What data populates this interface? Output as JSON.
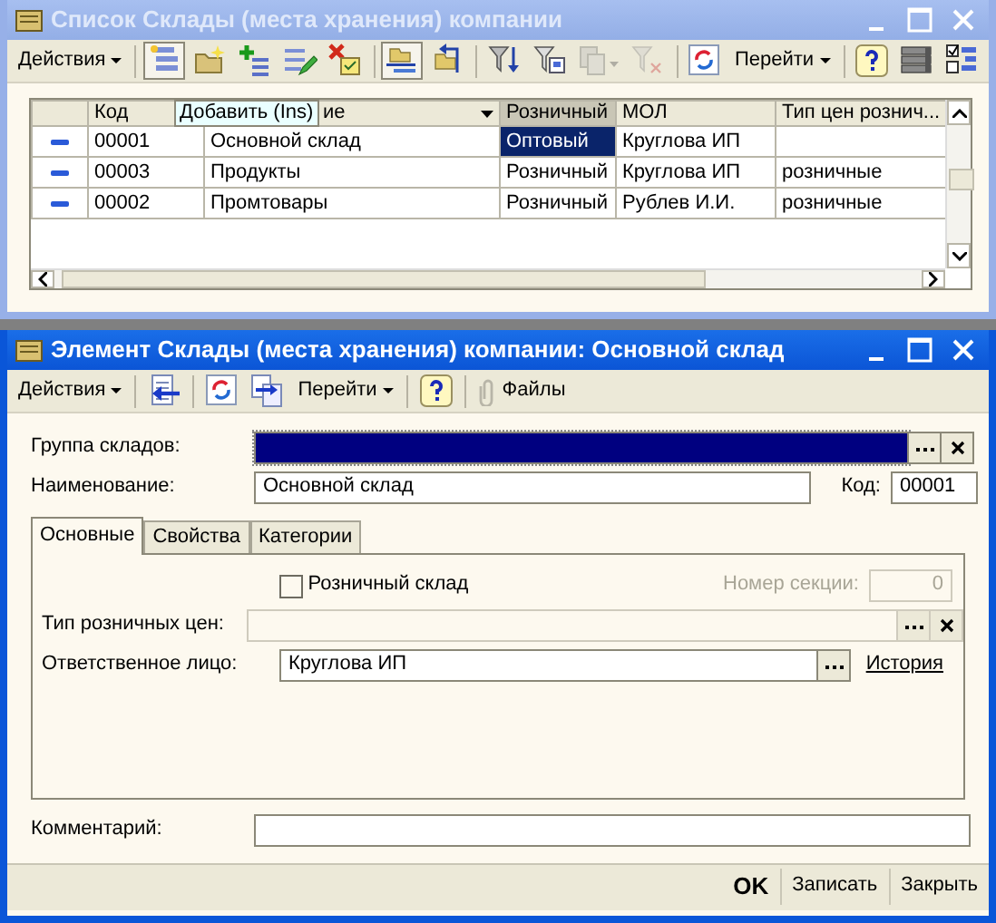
{
  "list_window": {
    "title": "Список Склады (места хранения) компании",
    "toolbar": [
      {
        "kind": "menu",
        "label": "Действия"
      },
      {
        "kind": "separator"
      },
      {
        "kind": "icon",
        "pressed": true,
        "disabled": false
      },
      {
        "kind": "icon",
        "pressed": false,
        "disabled": false
      },
      {
        "kind": "icon",
        "pressed": false,
        "disabled": false
      },
      {
        "kind": "icon",
        "pressed": false,
        "disabled": false
      },
      {
        "kind": "icon",
        "pressed": false,
        "disabled": false
      },
      {
        "kind": "separator"
      },
      {
        "kind": "icon",
        "pressed": true,
        "disabled": false
      },
      {
        "kind": "icon",
        "pressed": false,
        "disabled": false
      },
      {
        "kind": "separator"
      },
      {
        "kind": "icon",
        "pressed": false,
        "disabled": false
      },
      {
        "kind": "icon",
        "pressed": false,
        "disabled": false
      },
      {
        "kind": "icon",
        "pressed": false,
        "disabled": true
      },
      {
        "kind": "icon",
        "pressed": false,
        "disabled": true
      },
      {
        "kind": "separator"
      },
      {
        "kind": "icon",
        "pressed": false,
        "disabled": false
      },
      {
        "kind": "menu",
        "label": "Перейти"
      },
      {
        "kind": "separator"
      },
      {
        "kind": "icon",
        "pressed": false,
        "disabled": false
      },
      {
        "kind": "icon",
        "pressed": false,
        "disabled": false
      },
      {
        "kind": "icon",
        "pressed": false,
        "disabled": false
      }
    ],
    "table": {
      "columns": [
        {
          "label": "Код",
          "sorted": false
        },
        {
          "label": "ие",
          "sorted": false
        },
        {
          "label": "Розничный",
          "sorted": true
        },
        {
          "label": "МОЛ",
          "sorted": false
        },
        {
          "label": "Тип цен рознич...",
          "sorted": false
        }
      ],
      "tooltip": "Добавить (Ins)",
      "rows": [
        {
          "code": "00001",
          "name": "Основной склад",
          "type": "Оптовый",
          "mol": "Круглова ИП",
          "price_type": "",
          "selected": true
        },
        {
          "code": "00003",
          "name": "Продукты",
          "type": "Розничный",
          "mol": "Круглова ИП",
          "price_type": "розничные",
          "selected": false
        },
        {
          "code": "00002",
          "name": "Промтовары",
          "type": "Розничный",
          "mol": "Рублев И.И.",
          "price_type": "розничные",
          "selected": false
        }
      ]
    }
  },
  "element_window": {
    "title": "Элемент Склады (места хранения) компании: Основной склад",
    "toolbar": [
      {
        "kind": "menu",
        "label": "Действия"
      },
      {
        "kind": "separator"
      },
      {
        "kind": "icon",
        "pressed": false,
        "disabled": false
      },
      {
        "kind": "separator"
      },
      {
        "kind": "icon",
        "pressed": false,
        "disabled": false
      },
      {
        "kind": "icon",
        "pressed": false,
        "disabled": false
      },
      {
        "kind": "menu",
        "label": "Перейти"
      },
      {
        "kind": "separator"
      },
      {
        "kind": "icon",
        "pressed": false,
        "disabled": false
      },
      {
        "kind": "separator"
      },
      {
        "kind": "button",
        "label": "Файлы"
      }
    ],
    "group": {
      "label": "Группа складов:",
      "focused": true
    },
    "name": {
      "label": "Наименование:",
      "value": "Основной склад"
    },
    "code": {
      "label": "Код:",
      "value": "00001"
    },
    "tabs": [
      {
        "label": "Основные",
        "selected": true
      },
      {
        "label": "Свойства",
        "selected": false
      },
      {
        "label": "Категории",
        "selected": false
      }
    ],
    "retail": {
      "label": "Розничный склад",
      "checked": false
    },
    "section": {
      "label": "Номер секции:",
      "value": "0",
      "disabled": true
    },
    "price_type": {
      "label": "Тип розничных цен:",
      "disabled": true
    },
    "person": {
      "label": "Ответственное лицо:",
      "value": "Круглова ИП",
      "link": "История"
    },
    "comment": {
      "label": "Комментарий:"
    },
    "buttons": [
      {
        "label": "OK",
        "default": true
      },
      {
        "label": "Записать",
        "default": false
      },
      {
        "label": "Закрыть",
        "default": false
      }
    ]
  }
}
